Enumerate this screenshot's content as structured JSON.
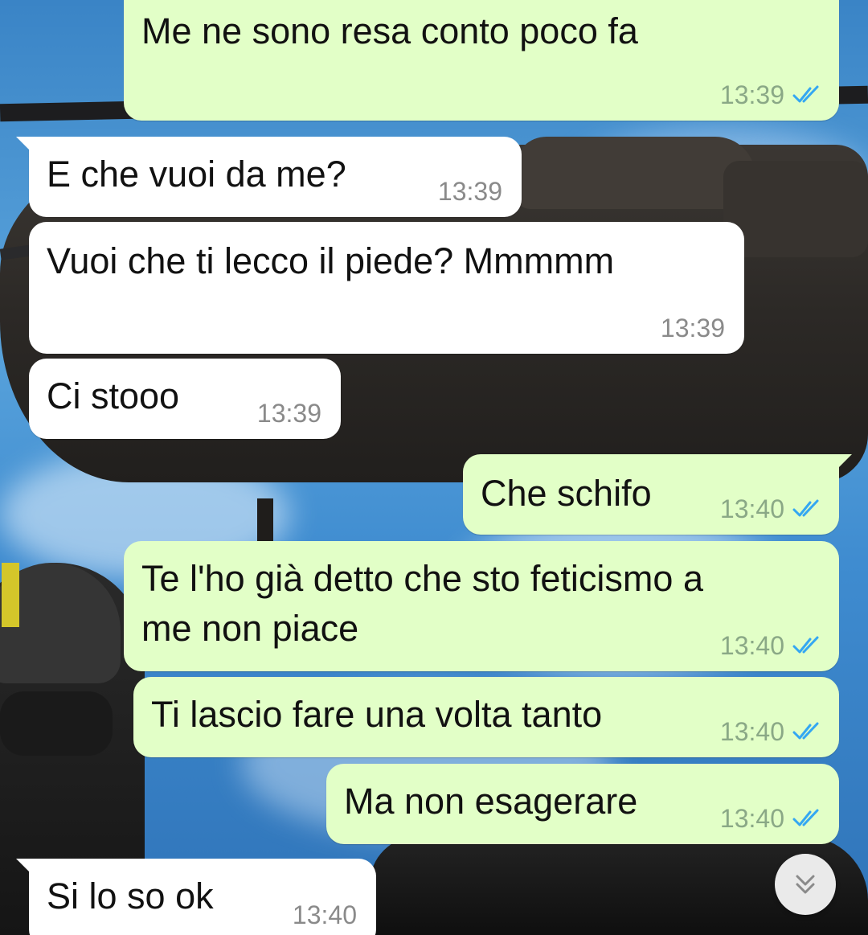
{
  "messages": [
    {
      "id": "m1",
      "direction": "outgoing",
      "text": "Me ne sono resa conto poco fa",
      "time": "13:39",
      "status": "read"
    },
    {
      "id": "m2",
      "direction": "incoming",
      "text": "E che vuoi da me?",
      "time": "13:39"
    },
    {
      "id": "m3",
      "direction": "incoming",
      "text": "Vuoi che ti lecco il piede? Mmmmm",
      "time": "13:39"
    },
    {
      "id": "m4",
      "direction": "incoming",
      "text": "Ci stooo",
      "time": "13:39"
    },
    {
      "id": "m5",
      "direction": "outgoing",
      "text": "Che schifo",
      "time": "13:40",
      "status": "read"
    },
    {
      "id": "m6",
      "direction": "outgoing",
      "text_line1": "Te l'ho già detto che sto feticismo a",
      "text_line2": "me non piace",
      "time": "13:40",
      "status": "read"
    },
    {
      "id": "m7",
      "direction": "outgoing",
      "text": "Ti lascio fare una volta tanto",
      "time": "13:40",
      "status": "read"
    },
    {
      "id": "m8",
      "direction": "outgoing",
      "text": "Ma non esagerare",
      "time": "13:40",
      "status": "read"
    },
    {
      "id": "m9",
      "direction": "incoming",
      "text": "Si lo so ok",
      "time": "13:40"
    }
  ],
  "icons": {
    "read_receipt": "double-check-icon",
    "scroll_down": "double-chevron-down-icon"
  },
  "colors": {
    "outgoing_bubble": "#e2ffc7",
    "incoming_bubble": "#ffffff",
    "read_check": "#34a7f2"
  }
}
